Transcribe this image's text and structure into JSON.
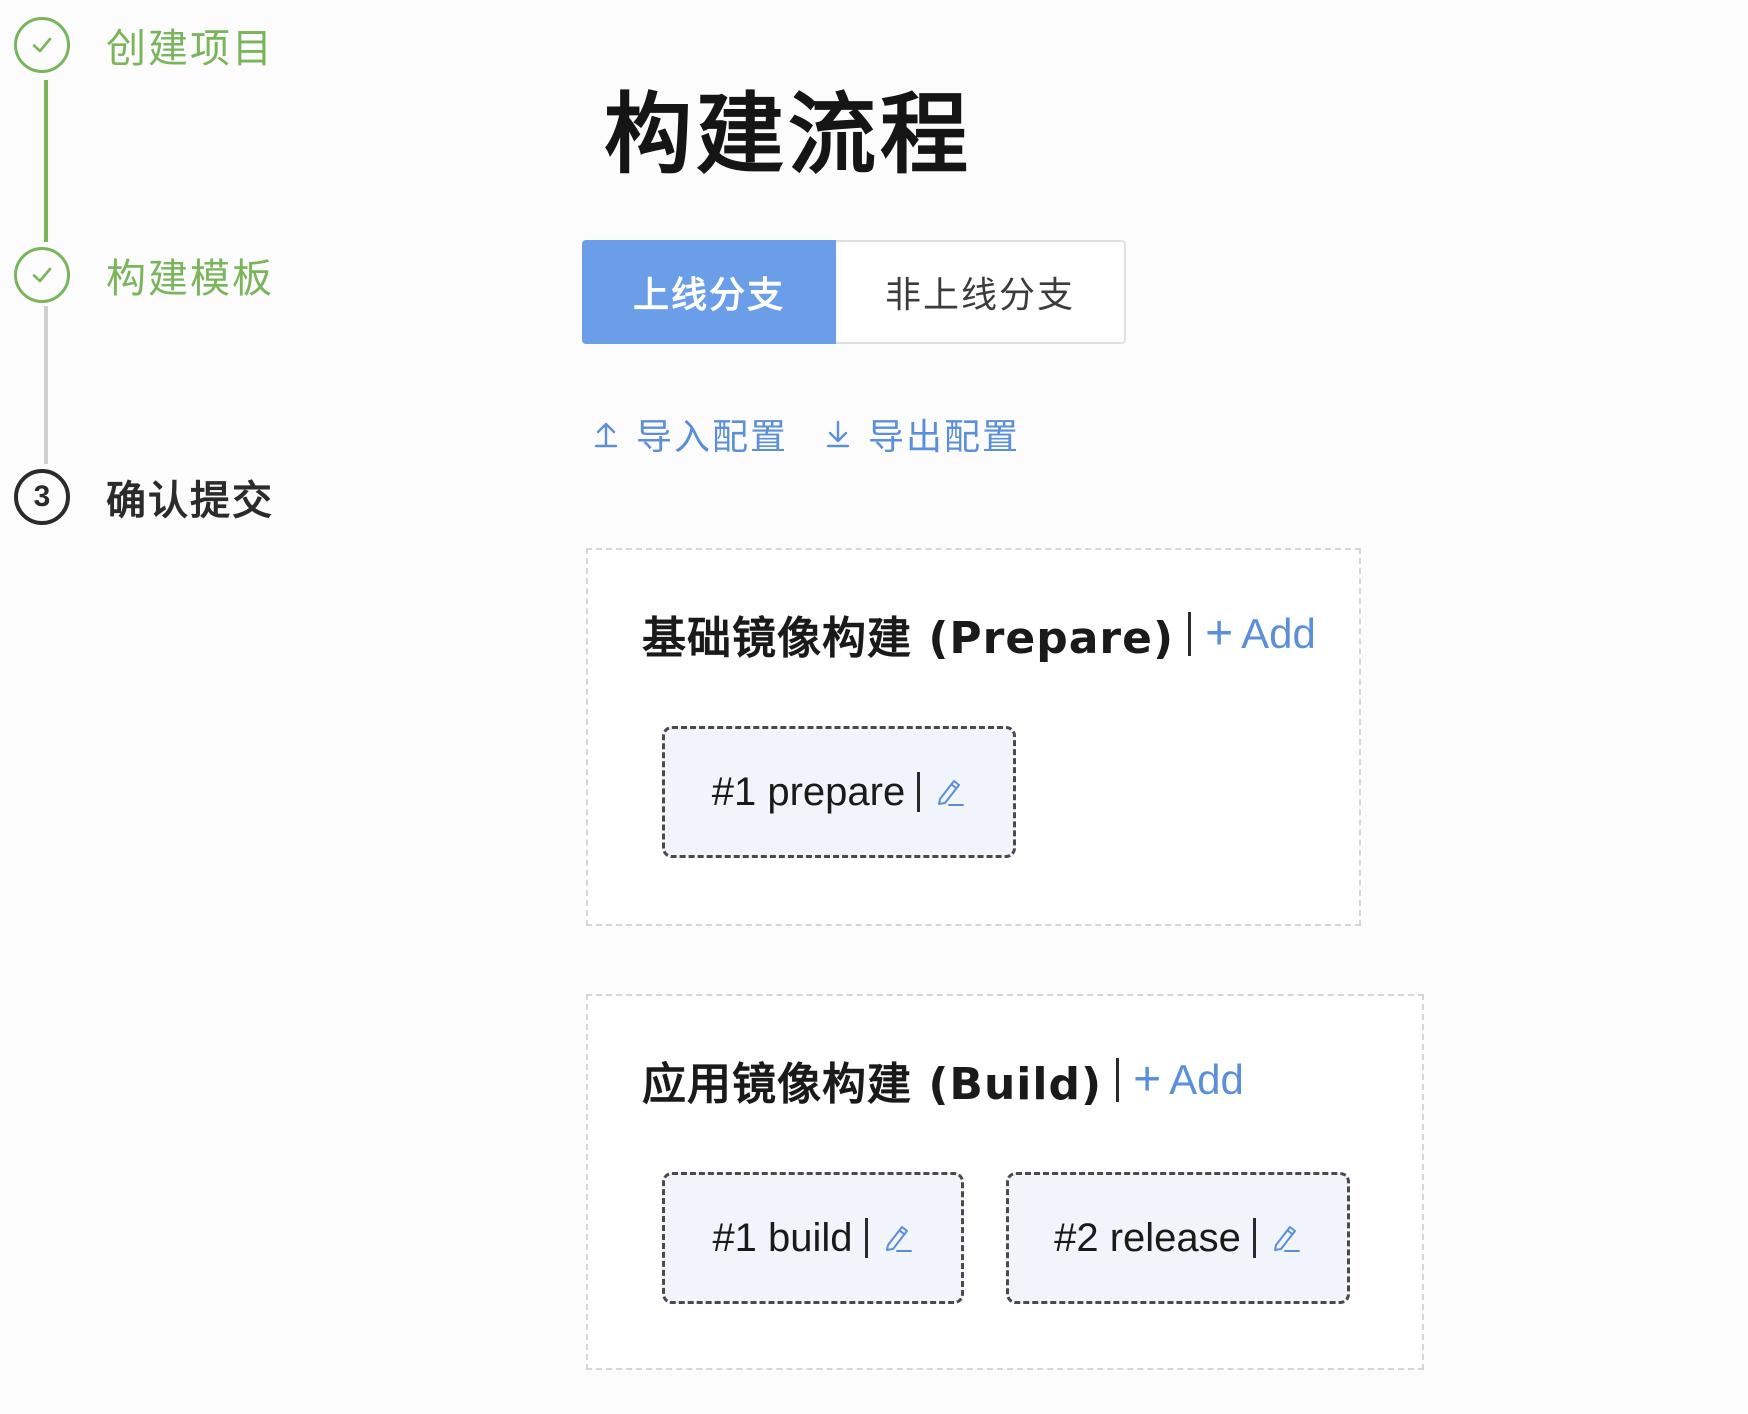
{
  "steps": [
    {
      "label": "创建项目",
      "status": "done"
    },
    {
      "label": "构建模板",
      "status": "done"
    },
    {
      "label": "确认提交",
      "status": "current",
      "number": "3"
    }
  ],
  "page_title": "构建流程",
  "tabs": [
    {
      "label": "上线分支",
      "active": true
    },
    {
      "label": "非上线分支",
      "active": false
    }
  ],
  "config_actions": {
    "import_label": "导入配置",
    "export_label": "导出配置"
  },
  "sections": {
    "prepare": {
      "title": "基础镜像构建 (Prepare)",
      "add_label": "Add",
      "jobs": [
        {
          "label": "#1 prepare"
        }
      ]
    },
    "build": {
      "title": "应用镜像构建 (Build)",
      "add_label": "Add",
      "jobs": [
        {
          "label": "#1 build"
        },
        {
          "label": "#2 release"
        }
      ]
    }
  },
  "icons": {
    "step_done": "check-icon",
    "import": "upload-icon",
    "export": "download-icon",
    "add": "plus-icon",
    "edit": "pencil-icon"
  },
  "colors": {
    "step_done": "#7ab55c",
    "step_pending_line": "#cfcfcf",
    "primary": "#6b9ee8",
    "link": "#5b8fd9",
    "card_bg": "#f1f5fb"
  }
}
